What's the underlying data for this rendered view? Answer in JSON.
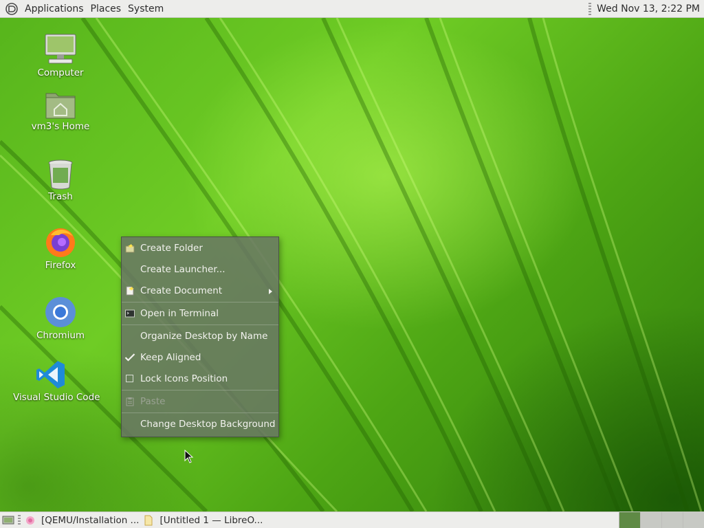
{
  "top_panel": {
    "menus": [
      "Applications",
      "Places",
      "System"
    ],
    "clock": "Wed Nov 13,  2:22 PM",
    "logo_icon": "mate-logo-icon"
  },
  "desktop": {
    "icons": [
      {
        "label": "Computer",
        "icon": "computer-icon"
      },
      {
        "label": "vm3's Home",
        "icon": "home-folder-icon"
      },
      {
        "label": "Trash",
        "icon": "trash-icon"
      },
      {
        "label": "Firefox",
        "icon": "firefox-icon"
      },
      {
        "label": "Chromium",
        "icon": "chromium-icon"
      },
      {
        "label": "Visual Studio Code",
        "icon": "vscode-icon"
      }
    ]
  },
  "context_menu": {
    "items": [
      {
        "label": "Create Folder",
        "icon": "new-folder-icon",
        "enabled": true
      },
      {
        "label": "Create Launcher...",
        "icon": "",
        "enabled": true
      },
      {
        "label": "Create Document",
        "icon": "new-document-icon",
        "enabled": true,
        "submenu": true
      },
      {
        "label": "Open in Terminal",
        "icon": "terminal-icon",
        "enabled": true
      },
      {
        "label": "Organize Desktop by Name",
        "icon": "",
        "enabled": true
      },
      {
        "label": "Keep Aligned",
        "icon": "checkmark-icon",
        "enabled": true,
        "checked": true
      },
      {
        "label": "Lock Icons Position",
        "icon": "checkbox-icon",
        "enabled": true,
        "checked": false
      },
      {
        "label": "Paste",
        "icon": "paste-icon",
        "enabled": false
      },
      {
        "label": "Change Desktop Background",
        "icon": "",
        "enabled": true
      }
    ]
  },
  "bottom_panel": {
    "tasks": [
      {
        "label": "[QEMU/Installation ...",
        "icon": "qemu-icon"
      },
      {
        "label": "[Untitled 1 — LibreO...",
        "icon": "libreoffice-icon"
      }
    ],
    "workspace_count": 4,
    "active_workspace": 1
  },
  "colors": {
    "panel_bg": "#ededeb",
    "menu_bg": "#69766a",
    "active_workspace": "#5f8a45"
  }
}
